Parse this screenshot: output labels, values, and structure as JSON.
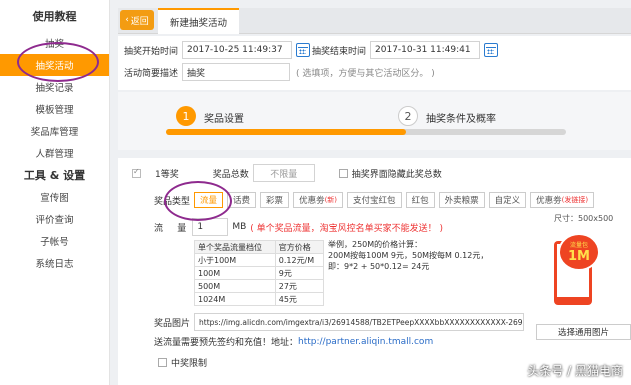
{
  "sidebar": {
    "section1": "使用教程",
    "items1": [
      "抽奖",
      "抽奖活动",
      "抽奖记录",
      "模板管理",
      "奖品库管理",
      "人群管理"
    ],
    "section2": "工具 & 设置",
    "items2": [
      "宣传图",
      "评价查询",
      "子帐号",
      "系统日志"
    ]
  },
  "topbar": {
    "back": "返回",
    "tab": "新建抽奖活动"
  },
  "form": {
    "start_label": "抽奖开始时间",
    "start_value": "2017-10-25 11:49:37",
    "end_label": "抽奖结束时间",
    "end_value": "2017-10-31 11:49:41",
    "desc_label": "活动简要描述",
    "desc_value": "抽奖",
    "desc_hint": "( 选填项，方便与其它活动区分。 )"
  },
  "steps": [
    {
      "num": "1",
      "label": "奖品设置"
    },
    {
      "num": "2",
      "label": "抽奖条件及概率"
    }
  ],
  "steps_progress": 0.6,
  "prize": {
    "name": "1等奖",
    "total_label": "奖品总数",
    "total_placeholder": "不限量",
    "hide_label": "抽奖界面隐藏此奖总数",
    "type_label": "奖品类型",
    "types": [
      "流量",
      "话费",
      "彩票",
      "优惠劵",
      "支付宝红包",
      "红包",
      "外卖粮票",
      "自定义",
      "优惠劵"
    ],
    "type_new1": "(新)",
    "type_new2": "(发链接)",
    "flow_label": "流     量",
    "flow_value": "1",
    "flow_unit": "MB",
    "flow_note": "( 单个奖品流量，淘宝风控名单买家不能发送！ )",
    "size_text": "尺寸：500x500",
    "table_headers": [
      "单个奖品流量档位",
      "官方价格"
    ],
    "table_rows": [
      [
        "小于100M",
        "0.12元/M"
      ],
      [
        "100M",
        "9元"
      ],
      [
        "500M",
        "27元"
      ],
      [
        "1024M",
        "45元"
      ]
    ],
    "example1": "举例，250M的价格计算：",
    "example2": "200M按每100M 9元，50M按每M 0.12元，",
    "example3": "即：9*2 + 50*0.12= 24元",
    "promo_top": "流量包",
    "promo_big": "1M",
    "image_label": "奖品图片",
    "image_url": "https://img.alicdn.com/imgextra/i3/26914588/TB2ETPeepXXXXbbXXXXXXXXXXXX-26914588",
    "select_image": "选择通用图片",
    "notice_text": "送流量需要预先签约和充值！地址：",
    "notice_link": "http://partner.aliqin.tmall.com",
    "limit_label": "中奖限制"
  },
  "watermark": "头条号 / 黑猫电商",
  "colors": {
    "accent": "#ff9900",
    "link": "#2a6cc7",
    "alert": "#ee3333",
    "annotation": "#8e2a8e"
  }
}
